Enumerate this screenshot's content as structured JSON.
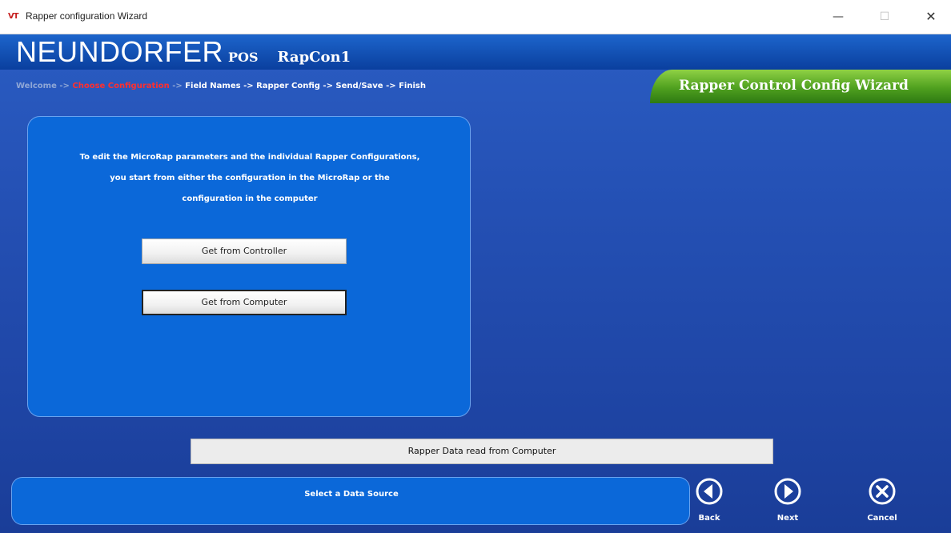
{
  "window": {
    "icon_text": "VT",
    "title": "Rapper configuration Wizard",
    "minimize": "—",
    "maximize": "☐",
    "close": "✕"
  },
  "header": {
    "brand": "NEUNDORFER",
    "brand_suffix": "POS",
    "app_name": "RapCon1"
  },
  "breadcrumb": {
    "welcome": "Welcome ->",
    "current": "Choose Configuration",
    "separator": "->",
    "rest": "Field Names -> Rapper Config -> Send/Save -> Finish"
  },
  "wizard_title": "Rapper Control Config Wizard",
  "panel": {
    "instruction_line1": "To edit the MicroRap parameters and the individual Rapper Configurations,",
    "instruction_line2": "you start from either the configuration in the MicroRap or the",
    "instruction_line3": "configuration in the computer",
    "button_controller": "Get from Controller",
    "button_computer": "Get from Computer"
  },
  "status_field": "Rapper Data read from Computer",
  "message": "Select a Data Source",
  "nav": {
    "back": "Back",
    "next": "Next",
    "cancel": "Cancel"
  },
  "colors": {
    "brand_blue": "#0a3f9e",
    "panel_blue": "#0b68d9",
    "wizard_green": "#4fa01f",
    "breadcrumb_active": "#ff2f2f"
  }
}
